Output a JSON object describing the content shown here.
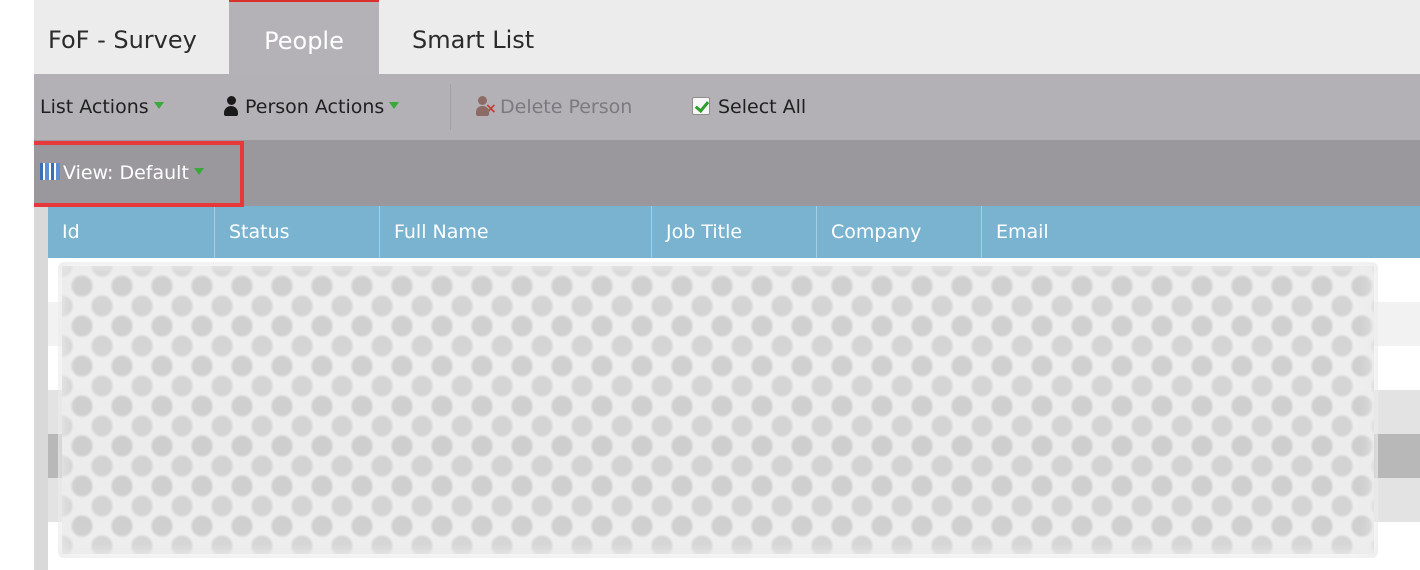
{
  "tabs": [
    {
      "label": "FoF - Survey",
      "active": false
    },
    {
      "label": "People",
      "active": true
    },
    {
      "label": "Smart List",
      "active": false
    }
  ],
  "toolbar": {
    "list_actions": "List Actions",
    "person_actions": "Person Actions",
    "delete_person": "Delete Person",
    "select_all": "Select All"
  },
  "view": {
    "label": "View: Default"
  },
  "grid": {
    "columns": [
      "Id",
      "Status",
      "Full Name",
      "Job Title",
      "Company",
      "Email"
    ]
  },
  "colors": {
    "active_tab_bg": "#b4b2b7",
    "active_tab_accent": "#d9302c",
    "header_blue": "#79b3d0",
    "highlight_red": "#e7393a",
    "caret_green": "#3aa83a"
  }
}
